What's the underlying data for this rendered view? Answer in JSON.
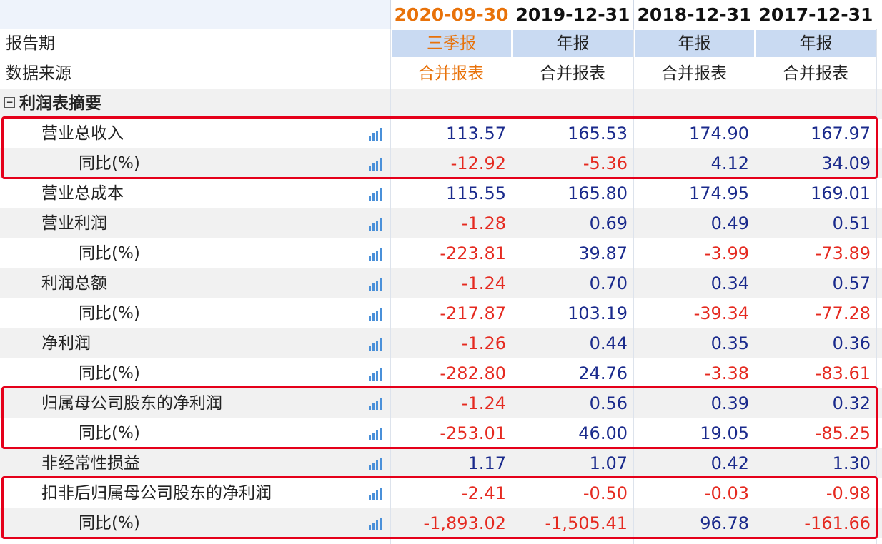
{
  "columns": [
    {
      "date": "2020-09-30",
      "period": "三季报",
      "source": "合并报表",
      "current": true
    },
    {
      "date": "2019-12-31",
      "period": "年报",
      "source": "合并报表",
      "current": false
    },
    {
      "date": "2018-12-31",
      "period": "年报",
      "source": "合并报表",
      "current": false
    },
    {
      "date": "2017-12-31",
      "period": "年报",
      "source": "合并报表",
      "current": false
    }
  ],
  "labels": {
    "period": "报告期",
    "source": "数据来源",
    "section": "利润表摘要",
    "toggle": "−"
  },
  "rows": [
    {
      "name": "营业总收入",
      "indent": 1,
      "values": [
        "113.57",
        "165.53",
        "174.90",
        "167.97"
      ]
    },
    {
      "name": "同比(%)",
      "indent": 2,
      "values": [
        "-12.92",
        "-5.36",
        "4.12",
        "34.09"
      ]
    },
    {
      "name": "营业总成本",
      "indent": 1,
      "values": [
        "115.55",
        "165.80",
        "174.95",
        "169.01"
      ]
    },
    {
      "name": "营业利润",
      "indent": 1,
      "values": [
        "-1.28",
        "0.69",
        "0.49",
        "0.51"
      ]
    },
    {
      "name": "同比(%)",
      "indent": 2,
      "values": [
        "-223.81",
        "39.87",
        "-3.99",
        "-73.89"
      ]
    },
    {
      "name": "利润总额",
      "indent": 1,
      "values": [
        "-1.24",
        "0.70",
        "0.34",
        "0.57"
      ]
    },
    {
      "name": "同比(%)",
      "indent": 2,
      "values": [
        "-217.87",
        "103.19",
        "-39.34",
        "-77.28"
      ]
    },
    {
      "name": "净利润",
      "indent": 1,
      "values": [
        "-1.26",
        "0.44",
        "0.35",
        "0.36"
      ]
    },
    {
      "name": "同比(%)",
      "indent": 2,
      "values": [
        "-282.80",
        "24.76",
        "-3.38",
        "-83.61"
      ]
    },
    {
      "name": "归属母公司股东的净利润",
      "indent": 1,
      "values": [
        "-1.24",
        "0.56",
        "0.39",
        "0.32"
      ]
    },
    {
      "name": "同比(%)",
      "indent": 2,
      "values": [
        "-253.01",
        "46.00",
        "19.05",
        "-85.25"
      ]
    },
    {
      "name": "非经常性损益",
      "indent": 1,
      "values": [
        "1.17",
        "1.07",
        "0.42",
        "1.30"
      ]
    },
    {
      "name": "扣非后归属母公司股东的净利润",
      "indent": 1,
      "values": [
        "-2.41",
        "-0.50",
        "-0.03",
        "-0.98"
      ]
    },
    {
      "name": "同比(%)",
      "indent": 2,
      "values": [
        "-1,893.02",
        "-1,505.41",
        "96.78",
        "-161.66"
      ]
    }
  ],
  "highlight_groups": [
    [
      0,
      1
    ],
    [
      9,
      10
    ],
    [
      12,
      13
    ]
  ],
  "colors": {
    "positive": "#1a2a8c",
    "negative": "#e52a20",
    "current": "#e8720a",
    "highlight": "#e5001a"
  }
}
